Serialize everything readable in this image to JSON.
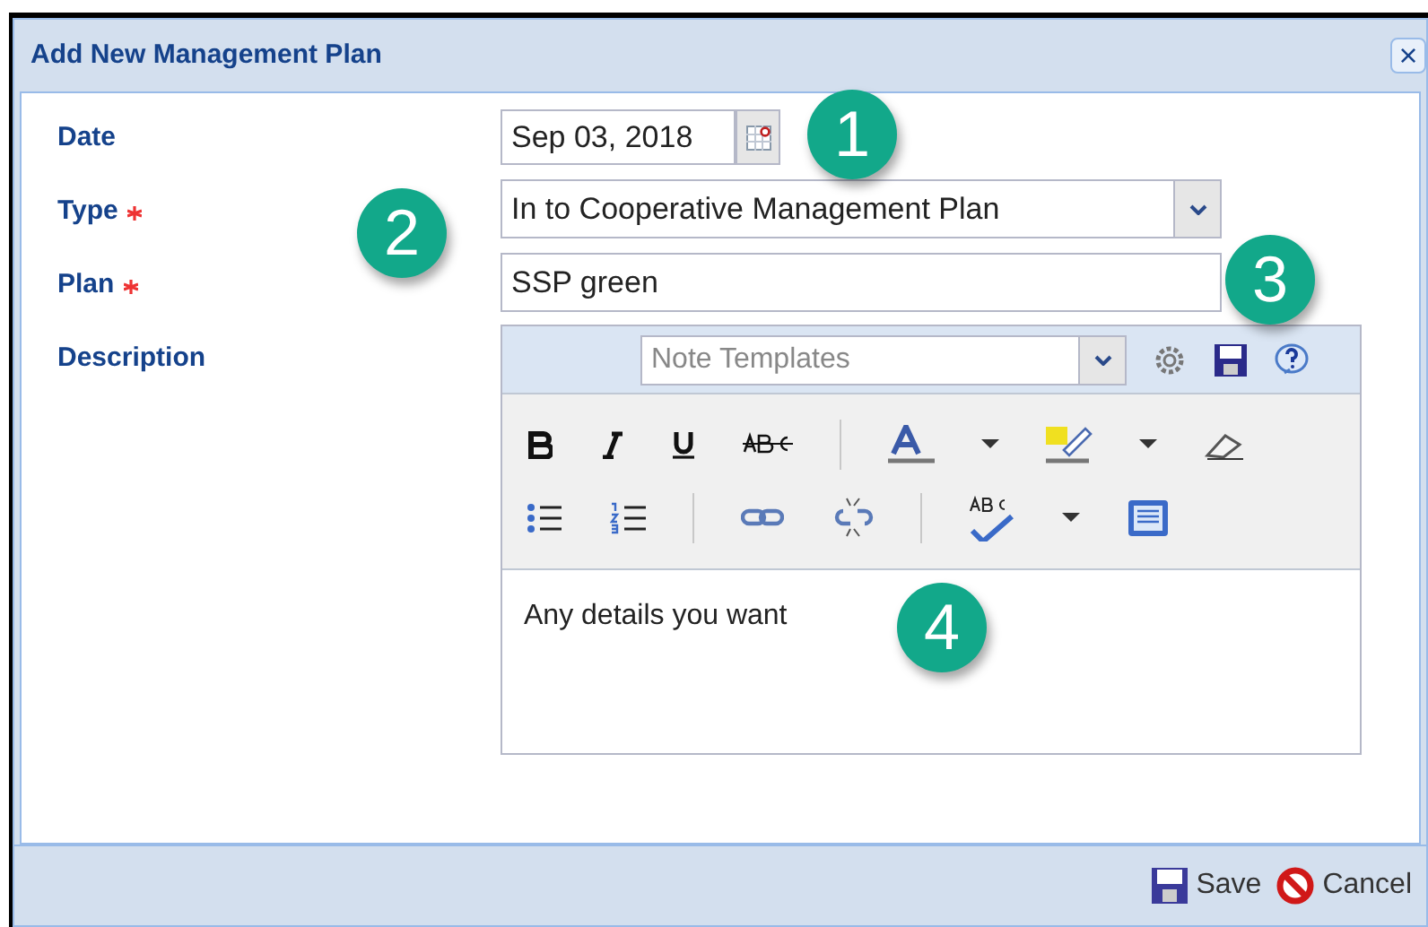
{
  "dialog": {
    "title": "Add New Management Plan",
    "close": "×"
  },
  "fields": [
    {
      "kind": "date",
      "label": "Date",
      "required": false,
      "value": "Sep 03, 2018"
    },
    {
      "kind": "select",
      "label": "Type",
      "required": true,
      "value": "In to Cooperative Management Plan"
    },
    {
      "kind": "text",
      "label": "Plan",
      "required": true,
      "value": "SSP green"
    },
    {
      "kind": "editor",
      "label": "Description",
      "required": false,
      "template_placeholder": "Note Templates",
      "value": "Any details you want"
    }
  ],
  "callouts": [
    {
      "number": "1"
    },
    {
      "number": "2"
    },
    {
      "number": "3"
    },
    {
      "number": "4"
    }
  ],
  "buttons": [
    {
      "kind": "save",
      "label": "Save"
    },
    {
      "kind": "cancel",
      "label": "Cancel"
    }
  ]
}
